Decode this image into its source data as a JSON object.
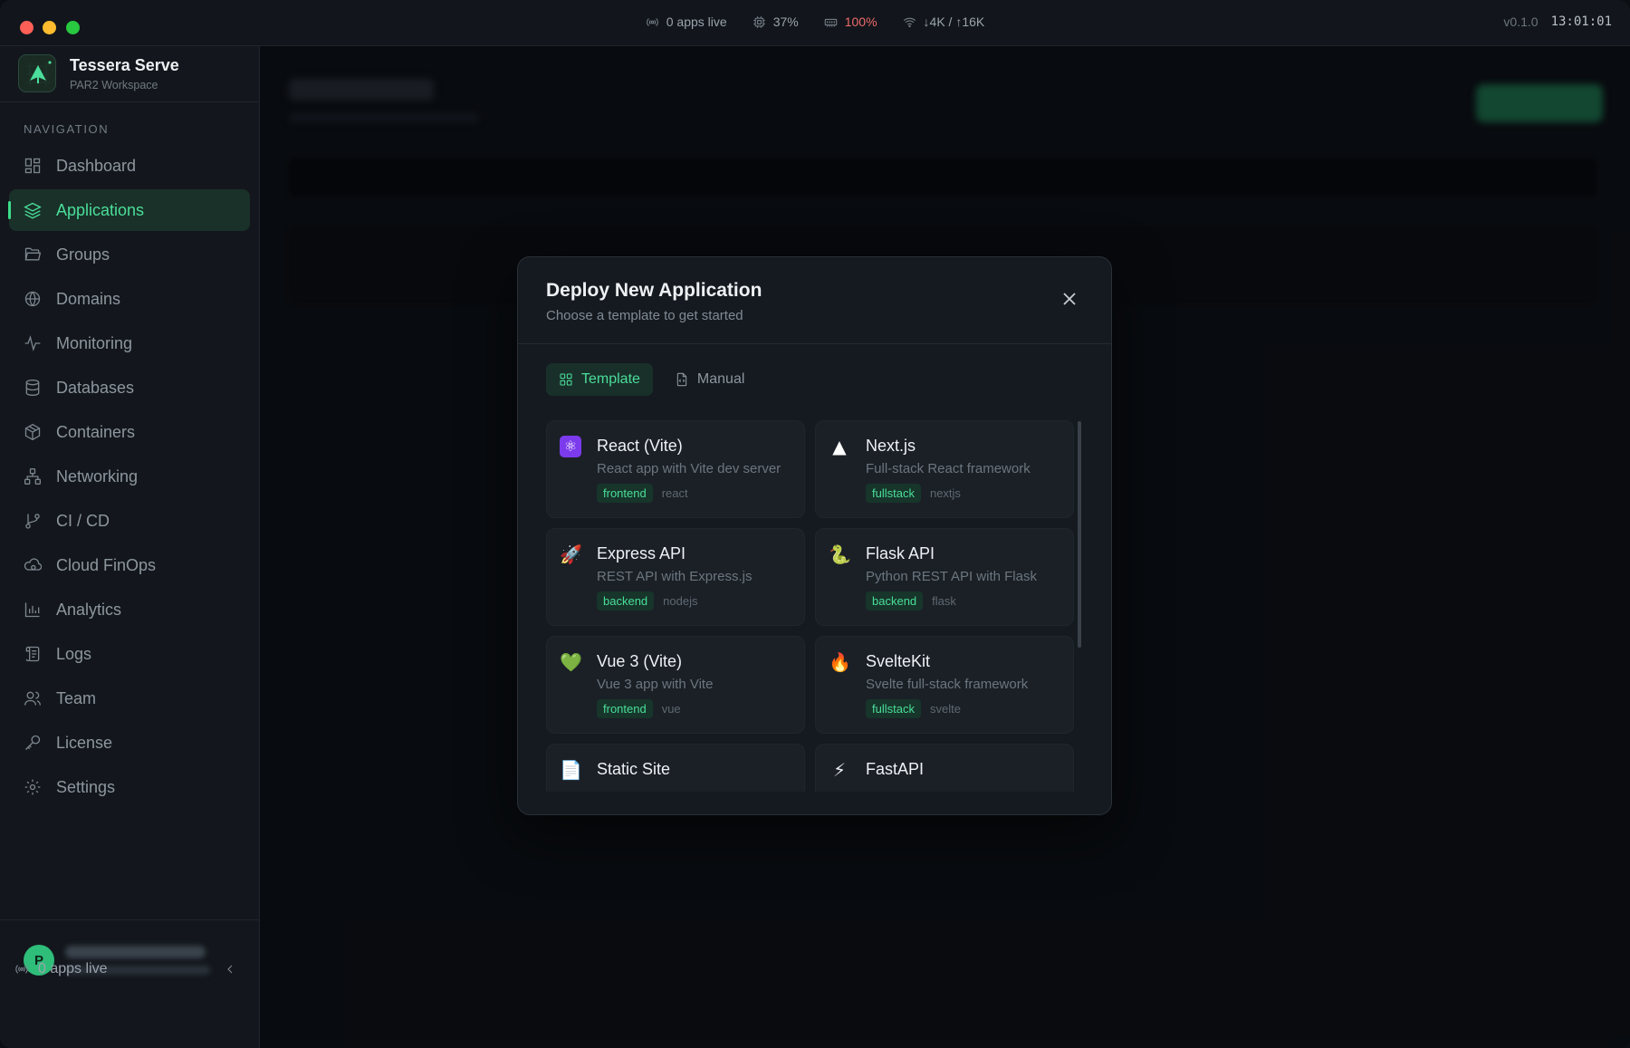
{
  "titlebar": {
    "apps_live": "0 apps live",
    "cpu": "37%",
    "memory": "100%",
    "network": "↓4K / ↑16K",
    "version": "v0.1.0",
    "clock": "13:01:01"
  },
  "brand": {
    "name": "Tessera Serve",
    "workspace": "PAR2 Workspace"
  },
  "sidebar": {
    "heading": "NAVIGATION",
    "items": [
      {
        "label": "Dashboard",
        "icon": "dashboard-icon"
      },
      {
        "label": "Applications",
        "icon": "layers-icon",
        "active": true
      },
      {
        "label": "Groups",
        "icon": "folder-icon"
      },
      {
        "label": "Domains",
        "icon": "globe-icon"
      },
      {
        "label": "Monitoring",
        "icon": "activity-icon"
      },
      {
        "label": "Databases",
        "icon": "database-icon"
      },
      {
        "label": "Containers",
        "icon": "box-icon"
      },
      {
        "label": "Networking",
        "icon": "network-icon"
      },
      {
        "label": "CI / CD",
        "icon": "git-branch-icon"
      },
      {
        "label": "Cloud FinOps",
        "icon": "cloud-icon"
      },
      {
        "label": "Analytics",
        "icon": "bar-chart-icon"
      },
      {
        "label": "Logs",
        "icon": "scroll-icon"
      },
      {
        "label": "Team",
        "icon": "users-icon"
      },
      {
        "label": "License",
        "icon": "key-icon"
      },
      {
        "label": "Settings",
        "icon": "gear-icon"
      }
    ],
    "user_initial": "P",
    "footer_status": "0 apps live"
  },
  "modal": {
    "title": "Deploy New Application",
    "subtitle": "Choose a template to get started",
    "tabs": [
      {
        "label": "Template",
        "active": true
      },
      {
        "label": "Manual",
        "active": false
      }
    ],
    "templates": [
      {
        "name": "React (Vite)",
        "desc": "React app with Vite dev server",
        "tag": "frontend",
        "slug": "react",
        "icon": "⚛"
      },
      {
        "name": "Next.js",
        "desc": "Full-stack React framework",
        "tag": "fullstack",
        "slug": "nextjs",
        "icon": "▲"
      },
      {
        "name": "Express API",
        "desc": "REST API with Express.js",
        "tag": "backend",
        "slug": "nodejs",
        "icon": "🚀"
      },
      {
        "name": "Flask API",
        "desc": "Python REST API with Flask",
        "tag": "backend",
        "slug": "flask",
        "icon": "🐍"
      },
      {
        "name": "Vue 3 (Vite)",
        "desc": "Vue 3 app with Vite",
        "tag": "frontend",
        "slug": "vue",
        "icon": "💚"
      },
      {
        "name": "SvelteKit",
        "desc": "Svelte full-stack framework",
        "tag": "fullstack",
        "slug": "svelte",
        "icon": "🔥"
      },
      {
        "name": "Static Site",
        "desc": "",
        "tag": "",
        "slug": "",
        "icon": "📄"
      },
      {
        "name": "FastAPI",
        "desc": "",
        "tag": "",
        "slug": "",
        "icon": "⚡"
      }
    ]
  },
  "colors": {
    "accent": "#4ade9a",
    "danger": "#ef6a6a",
    "background": "#0e1116"
  }
}
